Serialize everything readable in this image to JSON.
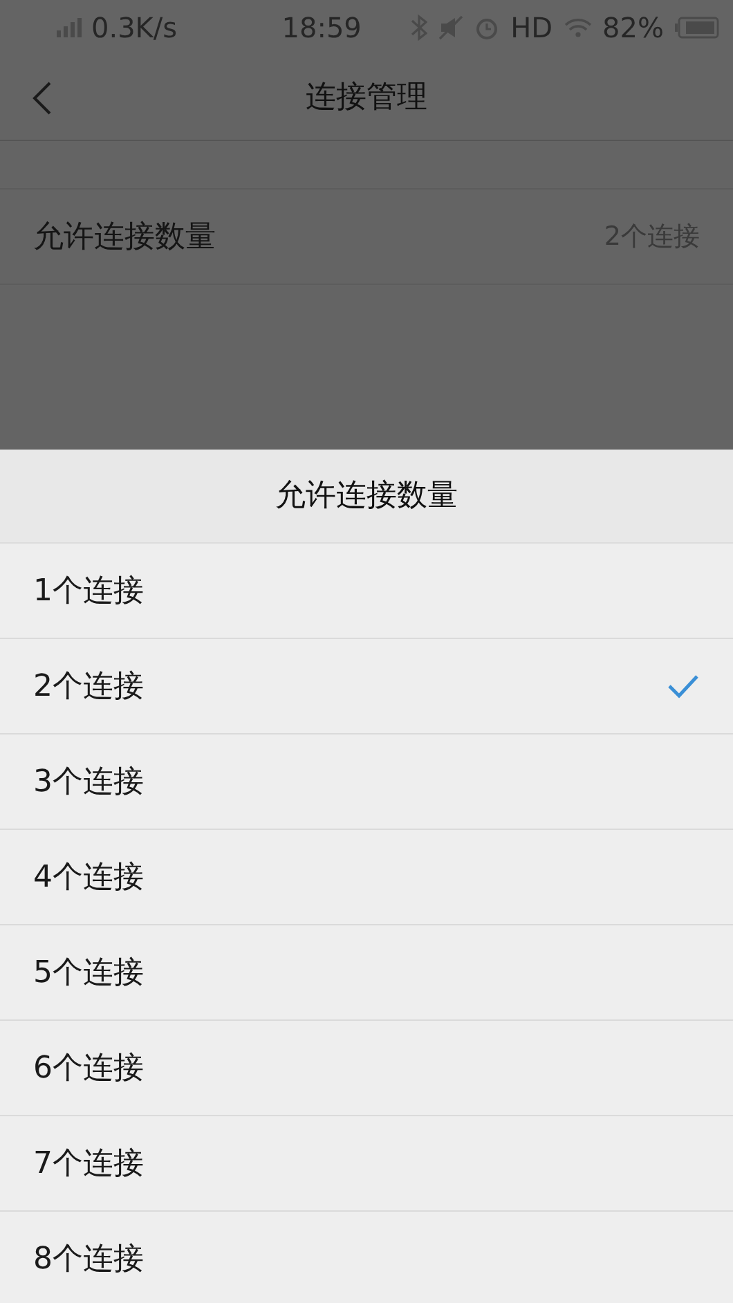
{
  "status_bar": {
    "net_speed": "0.3K/s",
    "time": "18:59",
    "network": "HD",
    "battery": "82%"
  },
  "nav": {
    "title": "连接管理"
  },
  "settings": [
    {
      "label": "允许连接数量",
      "value": "2个连接"
    }
  ],
  "sheet": {
    "title": "允许连接数量",
    "options": [
      {
        "label": "1个连接",
        "selected": false
      },
      {
        "label": "2个连接",
        "selected": true
      },
      {
        "label": "3个连接",
        "selected": false
      },
      {
        "label": "4个连接",
        "selected": false
      },
      {
        "label": "5个连接",
        "selected": false
      },
      {
        "label": "6个连接",
        "selected": false
      },
      {
        "label": "7个连接",
        "selected": false
      },
      {
        "label": "8个连接",
        "selected": false
      }
    ]
  }
}
